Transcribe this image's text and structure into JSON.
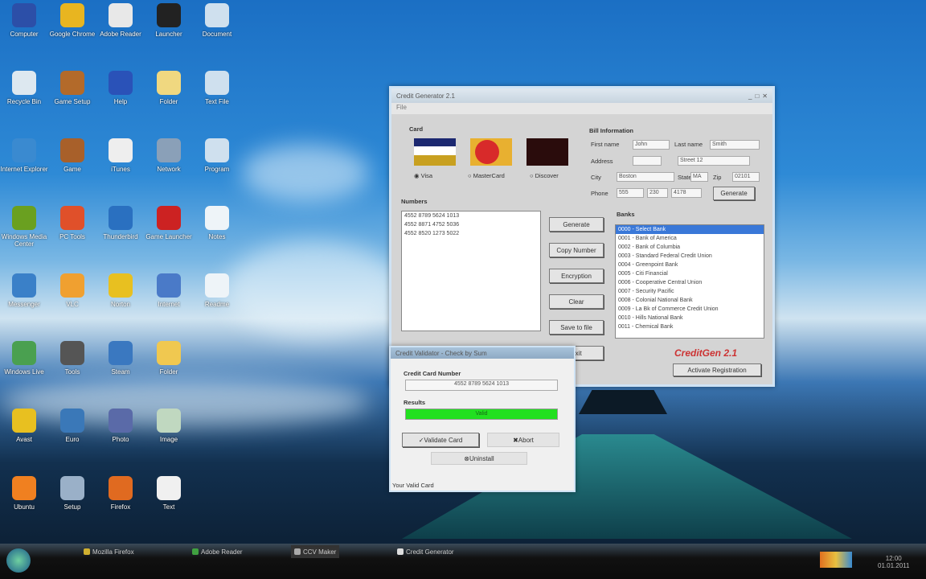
{
  "desktop": {
    "icons": [
      {
        "label": "Computer",
        "color": "#2c4fa8"
      },
      {
        "label": "Google Chrome",
        "color": "#e8b520"
      },
      {
        "label": "Adobe Reader",
        "color": "#e8e8e8"
      },
      {
        "label": "Launcher",
        "color": "#222"
      },
      {
        "label": "Document",
        "color": "#cfe0ee"
      },
      {
        "label": "Recycle Bin",
        "color": "#dde8f0"
      },
      {
        "label": "Game Setup",
        "color": "#b36a2a"
      },
      {
        "label": "Help",
        "color": "#2a52b8"
      },
      {
        "label": "Folder",
        "color": "#f0d880"
      },
      {
        "label": "Text File",
        "color": "#cfe0ee"
      },
      {
        "label": "Internet Explorer",
        "color": "#3a8ad0"
      },
      {
        "label": "Game",
        "color": "#a8602a"
      },
      {
        "label": "iTunes",
        "color": "#eeeeee"
      },
      {
        "label": "Network",
        "color": "#8aa0b8"
      },
      {
        "label": "Program",
        "color": "#cfe0ee"
      },
      {
        "label": "Windows Media Center",
        "color": "#6aa020"
      },
      {
        "label": "PC Tools",
        "color": "#e0502a"
      },
      {
        "label": "Thunderbird",
        "color": "#2a70c0"
      },
      {
        "label": "Game Launcher",
        "color": "#cc2222"
      },
      {
        "label": "Notes",
        "color": "#eef4f8"
      },
      {
        "label": "Messenger",
        "color": "#3a80c8"
      },
      {
        "label": "VLC",
        "color": "#f0a030"
      },
      {
        "label": "Norton",
        "color": "#e8c020"
      },
      {
        "label": "Internet",
        "color": "#4a7ac8"
      },
      {
        "label": "Readme",
        "color": "#eef4f8"
      },
      {
        "label": "Windows Live",
        "color": "#4aa050"
      },
      {
        "label": "Tools",
        "color": "#555"
      },
      {
        "label": "Steam",
        "color": "#3a78c0"
      },
      {
        "label": "Folder",
        "color": "#f0c850"
      },
      {
        "label": "Avast",
        "color": "#e8c020"
      },
      {
        "label": "Euro",
        "color": "#3a78b8"
      },
      {
        "label": "Photo",
        "color": "#5a6aa8"
      },
      {
        "label": "Image",
        "color": "#c0d8c0"
      },
      {
        "label": "Ubuntu",
        "color": "#f08020"
      },
      {
        "label": "Setup",
        "color": "#9ab0c8"
      },
      {
        "label": "Firefox",
        "color": "#e06a20"
      },
      {
        "label": "Text",
        "color": "#f0f0f0"
      }
    ]
  },
  "main_window": {
    "title": "Credit Generator 2.1",
    "menu": "File",
    "card_group": "Card",
    "card_options": [
      "Visa",
      "MasterCard",
      "Discover"
    ],
    "info_group": "Bill Information",
    "info_labels": [
      "First name",
      "Last name",
      "Address",
      "City",
      "State",
      "Zip",
      "Phone"
    ],
    "info_values": [
      "John",
      "Smith",
      "Street 12",
      "Boston",
      "MA",
      "02101",
      "555",
      "230",
      "4178"
    ],
    "generate_label": "Generate",
    "numbers_group": "Numbers",
    "numbers": [
      "4552 8789 5624 1013",
      "4552 8871 4752 5036",
      "4552 8520 1273 5022"
    ],
    "buttons": [
      "Generate",
      "Copy Number",
      "Encryption",
      "Clear",
      "Save to file",
      "Exit"
    ],
    "banks_group": "Banks",
    "banks": [
      "0000 - Select Bank",
      "0001 - Bank of America",
      "0002 - Bank of Columbia",
      "0003 - Standard Federal Credit Union",
      "0004 - Greenpoint Bank",
      "0005 - Citi Financial",
      "0006 - Cooperative Central Union",
      "0007 - Security Pacific",
      "0008 - Colonial National Bank",
      "0009 - La Bk of Commerce Credit Union",
      "0010 - Hills National Bank",
      "0011 - Chemical Bank"
    ],
    "logo": "CreditGen 2.1",
    "register_label": "Activate Registration"
  },
  "dialog": {
    "title": "Credit Validator - Check by Sum",
    "group": "Credit Card Number",
    "card_value": "4552 8789 5624 1013",
    "results_label": "Results",
    "progress": 100,
    "progress_text": "Valid",
    "buttons": [
      "Validate Card",
      "Abort",
      "Uninstall"
    ],
    "status": "Your Valid Card"
  },
  "taskbar": {
    "items": [
      "Mozilla Firefox",
      "Adobe Reader",
      "CCV Maker",
      "Credit Generator"
    ],
    "time": "12:00",
    "date": "01.01.2011"
  }
}
